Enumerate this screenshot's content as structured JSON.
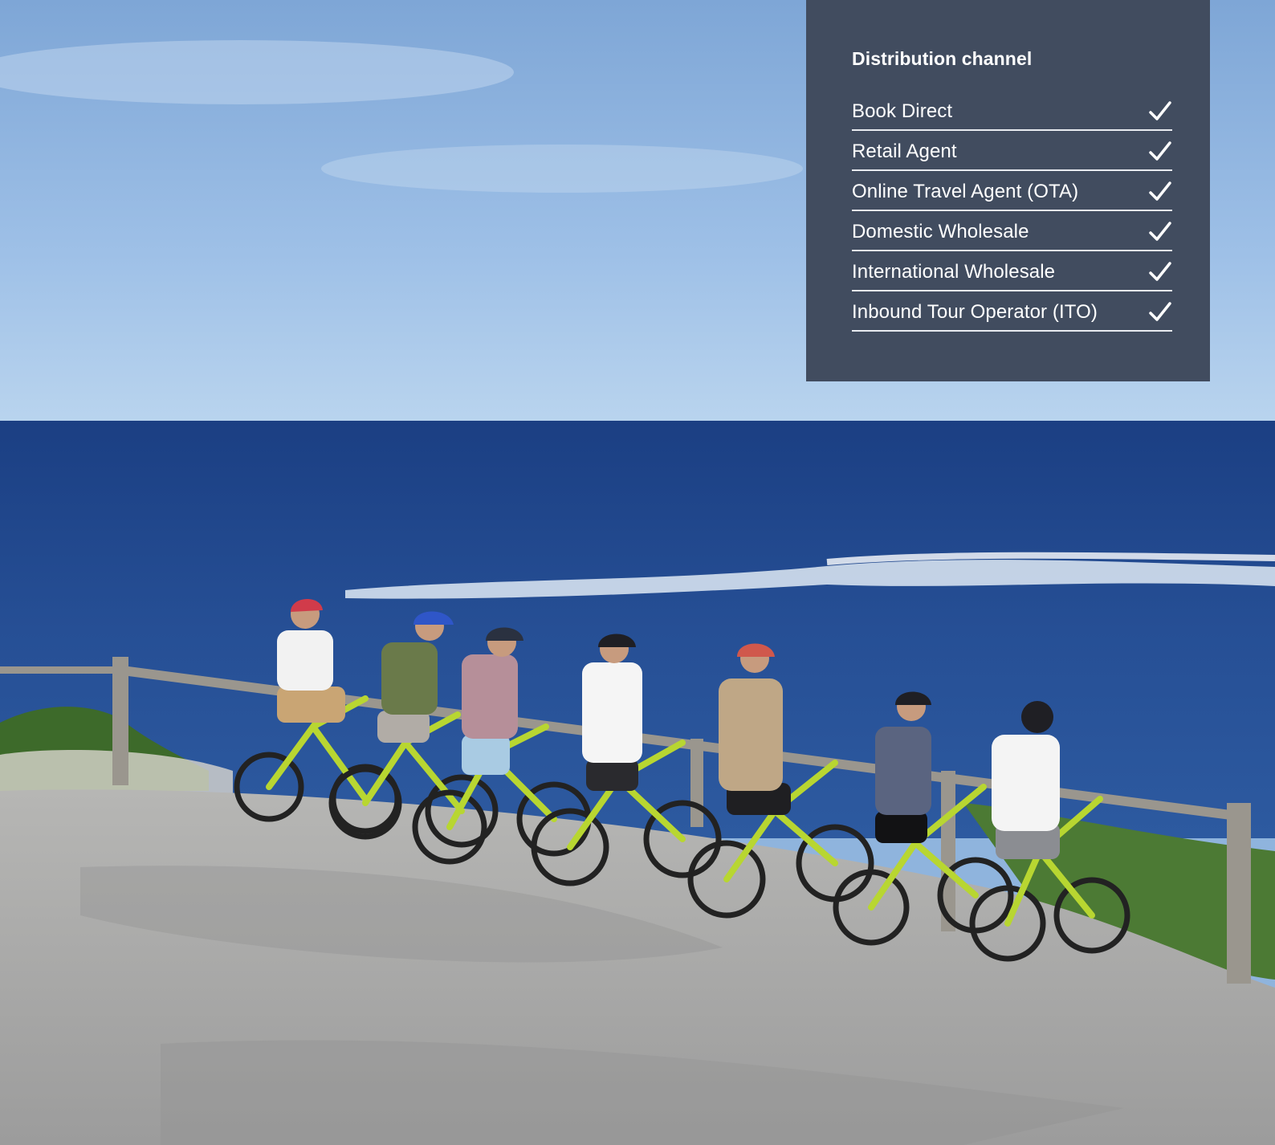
{
  "panel": {
    "title": "Distribution channel",
    "items": [
      {
        "label": "Book Direct",
        "checked": true,
        "icon": "check-icon"
      },
      {
        "label": "Retail Agent",
        "checked": true,
        "icon": "check-icon"
      },
      {
        "label": "Online Travel Agent (OTA)",
        "checked": true,
        "icon": "check-icon"
      },
      {
        "label": "Domestic Wholesale",
        "checked": true,
        "icon": "check-icon"
      },
      {
        "label": "International Wholesale",
        "checked": true,
        "icon": "check-icon"
      },
      {
        "label": "Inbound Tour Operator (ITO)",
        "checked": true,
        "icon": "check-icon"
      }
    ]
  },
  "colors": {
    "panel_bg": "#414c5f",
    "sky_top": "#7ea6d6",
    "sky_horizon": "#b9d4ee",
    "ocean": "#1f4c8f",
    "path": "#a9a9a9",
    "bike_frame": "#b8d631"
  }
}
